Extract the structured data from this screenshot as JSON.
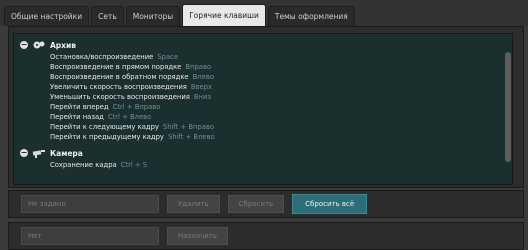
{
  "tabs": [
    {
      "label": "Общие настройки"
    },
    {
      "label": "Сеть"
    },
    {
      "label": "Мониторы"
    },
    {
      "label": "Горячие клавиши"
    },
    {
      "label": "Темы оформления"
    }
  ],
  "tree": {
    "archive": {
      "title": "Архив",
      "items": [
        {
          "label": "Остановка/воспроизведение",
          "key": "Space"
        },
        {
          "label": "Воспроизведение в прямом порядке",
          "key": "Вправо"
        },
        {
          "label": "Воспроизведение в обратном порядке",
          "key": "Влево"
        },
        {
          "label": "Увеличить скорость воспроизведения",
          "key": "Вверх"
        },
        {
          "label": "Уменьшить скорость воспроизведения",
          "key": "Вниз"
        },
        {
          "label": "Перейти вперед",
          "key": "Ctrl + Вправо"
        },
        {
          "label": "Перейти назад",
          "key": "Ctrl + Влево"
        },
        {
          "label": "Перейти к следующему кадру",
          "key": "Shift + Вправо"
        },
        {
          "label": "Перейти к предыдущему кадру",
          "key": "Shift + Влево"
        }
      ]
    },
    "camera": {
      "title": "Камера",
      "items": [
        {
          "label": "Сохранение кадра",
          "key": "Ctrl + S"
        }
      ]
    }
  },
  "controls": {
    "shortcut_placeholder": "Не задано",
    "delete_label": "Удалить",
    "reset_label": "Сбросить",
    "reset_all_label": "Сбросить всё",
    "action_placeholder": "Нет",
    "assign_label": "Назначить"
  }
}
